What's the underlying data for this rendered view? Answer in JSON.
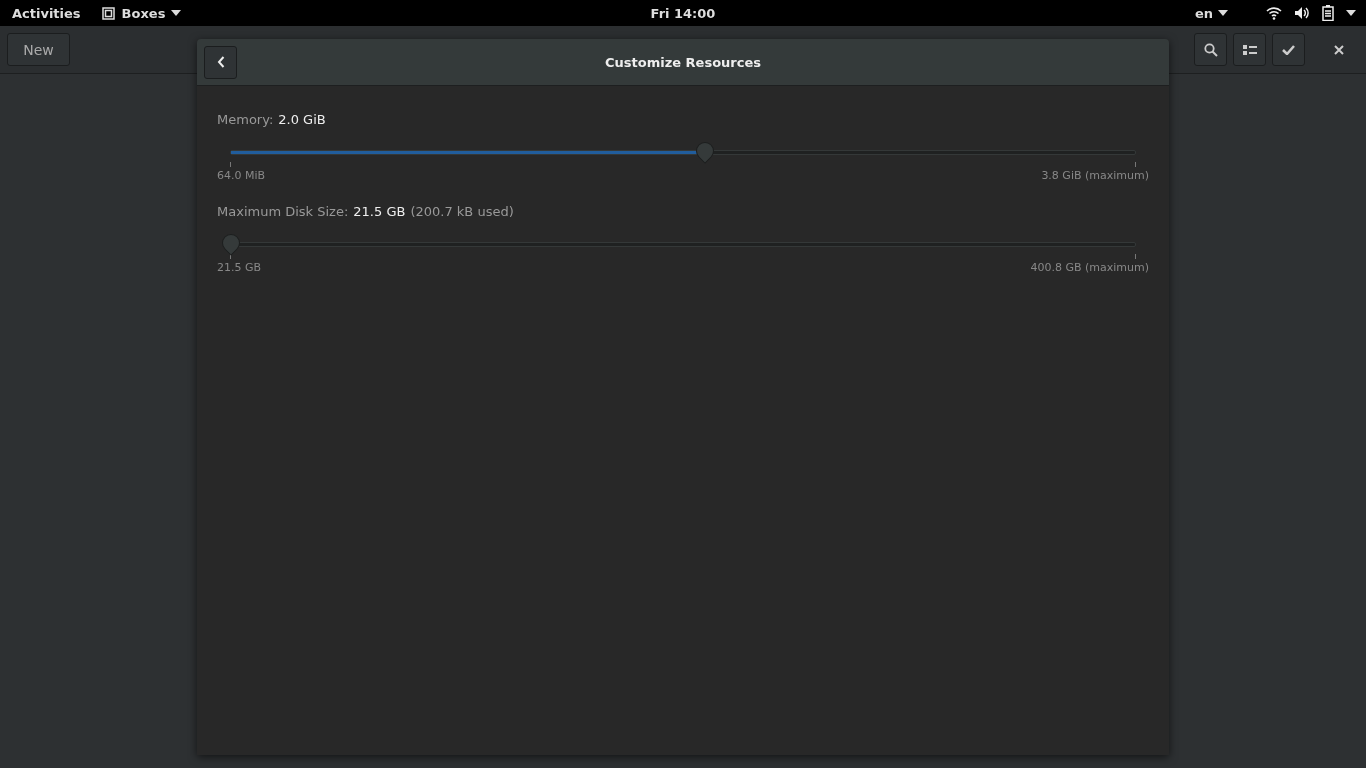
{
  "top_bar": {
    "activities": "Activities",
    "app_menu": "Boxes",
    "clock": "Fri 14:00",
    "language": "en"
  },
  "header_bar": {
    "new_button": "New"
  },
  "dialog": {
    "title": "Customize Resources",
    "sliders": [
      {
        "label": "Memory:",
        "value": "2.0 GiB",
        "level": 0.524,
        "min_label": "64.0 MiB",
        "max_label": "3.8 GiB (maximum)"
      },
      {
        "label": "Maximum Disk Size:",
        "value": "21.5 GB",
        "note": "(200.7 kB used)",
        "level": 0,
        "min_label": "21.5 GB",
        "max_label": "400.8 GB (maximum)"
      }
    ]
  }
}
